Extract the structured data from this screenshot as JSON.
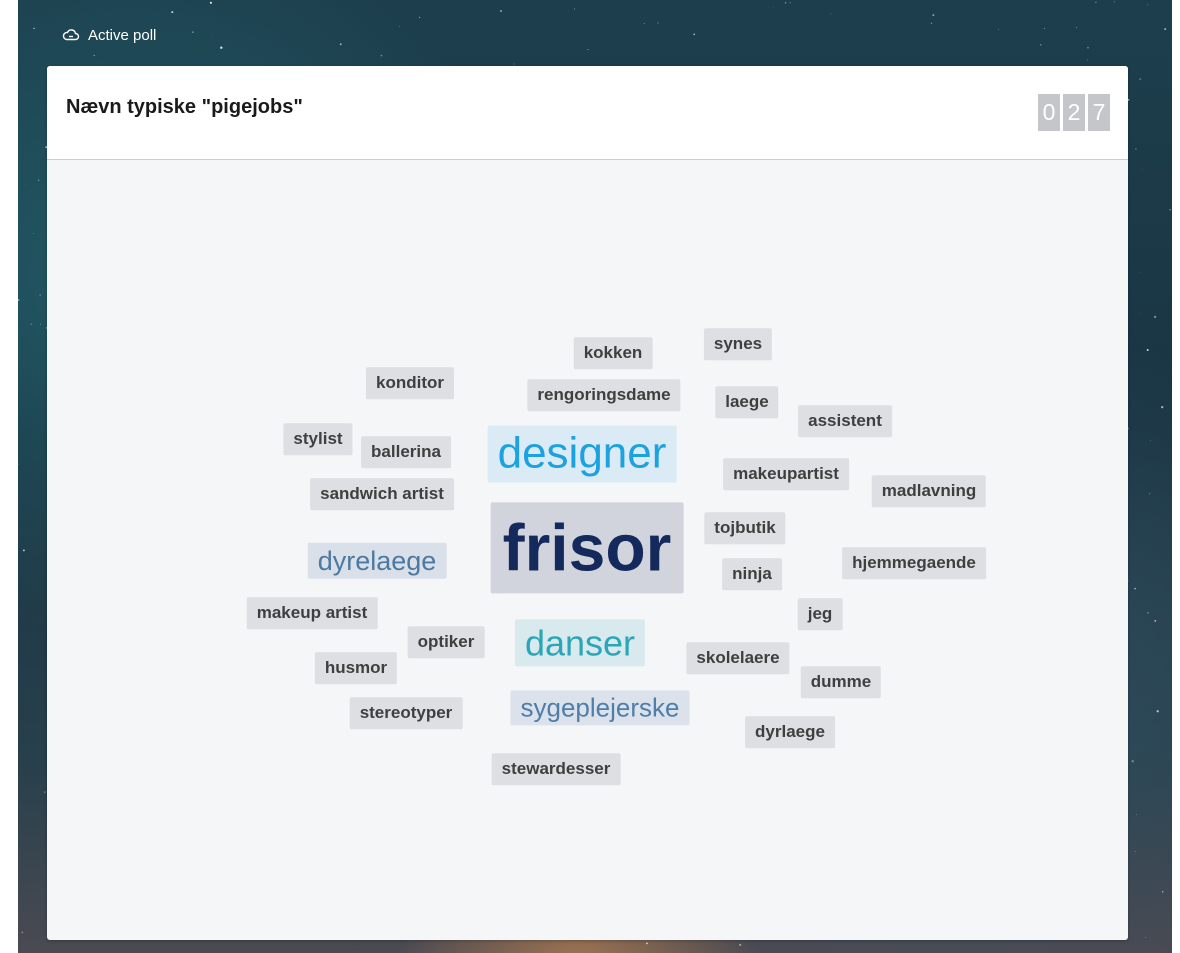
{
  "topbar": {
    "label": "Active poll",
    "icon": "cloud-icon"
  },
  "poll": {
    "title": "Nævn typiske \"pigejobs\"",
    "counter": [
      "0",
      "2",
      "7"
    ]
  },
  "colors": {
    "frisor": "#142a5c",
    "designer": "#1da2e0",
    "danser": "#2aa6b8",
    "dyrelaege": "#4d79a0",
    "sygeplejerske": "#4f7ea8",
    "default": "#3f3f3f"
  },
  "words": [
    {
      "text": "frisor"
    },
    {
      "text": "designer"
    },
    {
      "text": "danser"
    },
    {
      "text": "dyrelaege"
    },
    {
      "text": "sygeplejerske"
    },
    {
      "text": "kokken"
    },
    {
      "text": "synes"
    },
    {
      "text": "konditor"
    },
    {
      "text": "rengoringsdame"
    },
    {
      "text": "laege"
    },
    {
      "text": "assistent"
    },
    {
      "text": "stylist"
    },
    {
      "text": "ballerina"
    },
    {
      "text": "makeupartist"
    },
    {
      "text": "madlavning"
    },
    {
      "text": "sandwich artist"
    },
    {
      "text": "tojbutik"
    },
    {
      "text": "hjemmegaende"
    },
    {
      "text": "ninja"
    },
    {
      "text": "makeup artist"
    },
    {
      "text": "jeg"
    },
    {
      "text": "optiker"
    },
    {
      "text": "skolelaere"
    },
    {
      "text": "husmor"
    },
    {
      "text": "dumme"
    },
    {
      "text": "stereotyper"
    },
    {
      "text": "dyrlaege"
    },
    {
      "text": "stewardesser"
    }
  ]
}
